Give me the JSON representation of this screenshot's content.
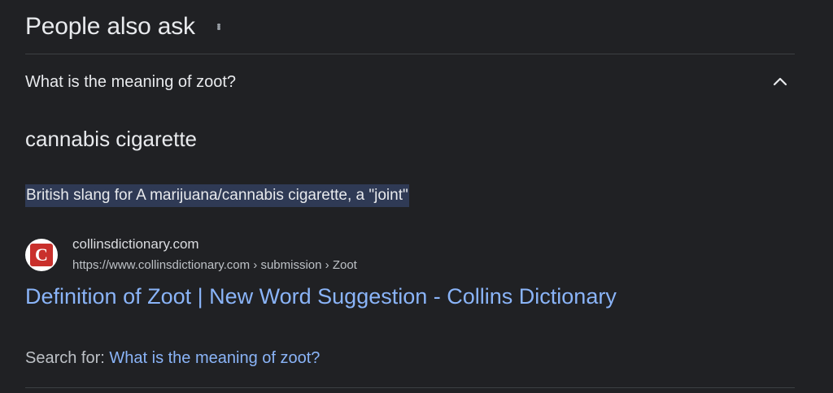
{
  "header": {
    "title": "People also ask",
    "more_icon": "more-vert-icon"
  },
  "question": {
    "text": "What is the meaning of zoot?",
    "expand_icon": "chevron-up-icon"
  },
  "answer": {
    "heading": "cannabis cigarette",
    "snippet": "British slang for A marijuana/cannabis cigarette, a \"joint\"",
    "snippet_highlight_color": "#2f3a55"
  },
  "source": {
    "favicon_letter": "C",
    "favicon_color": "#c9302c",
    "site": "collinsdictionary.com",
    "url": "https://www.collinsdictionary.com › submission › Zoot"
  },
  "result": {
    "link_text": "Definition of Zoot | New Word Suggestion - Collins Dictionary",
    "link_color": "#8ab4f8"
  },
  "search_for": {
    "label": "Search for:",
    "query": "What is the meaning of zoot?"
  },
  "colors": {
    "background": "#202124",
    "text": "#e8eaed",
    "divider": "#3c4043"
  }
}
